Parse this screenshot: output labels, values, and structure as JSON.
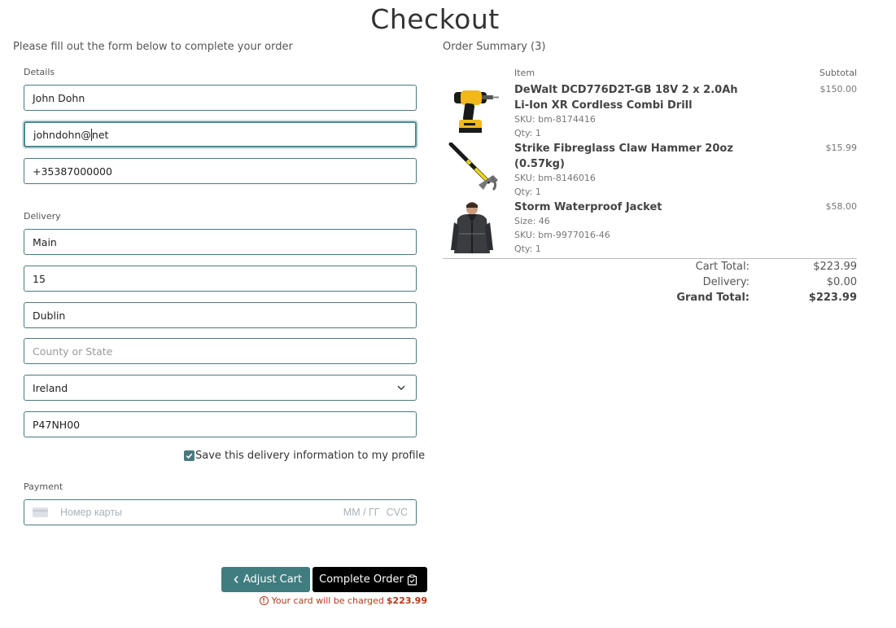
{
  "page": {
    "title": "Checkout",
    "intro": "Please fill out the form below to complete your order"
  },
  "form": {
    "details_label": "Details",
    "full_name": "John Dohn",
    "email_before_caret": "johndohn@",
    "email_after_caret": "net",
    "phone": "+35387000000",
    "delivery_label": "Delivery",
    "street": "Main",
    "house_number": "15",
    "city": "Dublin",
    "county_placeholder": "County or State",
    "country": "Ireland",
    "postcode": "P47NH00",
    "save_info_label": "Save this delivery information to my profile",
    "save_info_checked": true,
    "payment_label": "Payment",
    "card_number_placeholder": "Номер карты",
    "card_expiry_placeholder": "ММ / ГГ",
    "card_cvc_placeholder": "CVC"
  },
  "buttons": {
    "adjust_cart": "Adjust Cart",
    "complete_order": "Complete Order"
  },
  "charge_note": {
    "text": "Your card will be charged",
    "amount": "$223.99"
  },
  "summary": {
    "heading": "Order Summary (3)",
    "col_item": "Item",
    "col_subtotal": "Subtotal",
    "items": [
      {
        "name": "DeWalt DCD776D2T-GB 18V 2 x 2.0Ah Li-Ion XR Cordless Combi Drill",
        "size": "",
        "sku": "SKU: bm-8174416",
        "qty": "Qty: 1",
        "price": "$150.00"
      },
      {
        "name": "Strike Fibreglass Claw Hammer 20oz (0.57kg)",
        "size": "",
        "sku": "SKU: bm-8146016",
        "qty": "Qty: 1",
        "price": "$15.99"
      },
      {
        "name": "Storm Waterproof Jacket",
        "size": "Size: 46",
        "sku": "SKU: bm-9977016-46",
        "qty": "Qty: 1",
        "price": "$58.00"
      }
    ],
    "cart_total_label": "Cart Total:",
    "cart_total": "$223.99",
    "delivery_label": "Delivery:",
    "delivery": "$0.00",
    "grand_total_label": "Grand Total:",
    "grand_total": "$223.99"
  },
  "colors": {
    "accent": "#3f7d80",
    "warning": "#b43a1a",
    "complete_button": "#000000"
  }
}
